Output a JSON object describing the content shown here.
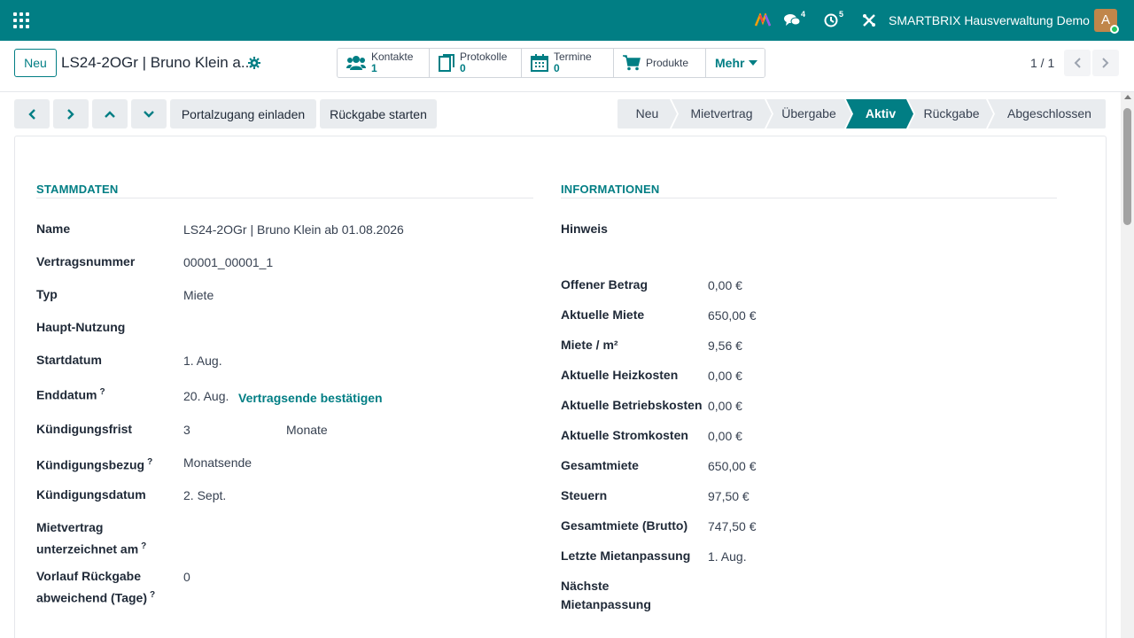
{
  "topbar": {
    "bg_color": "#017e84",
    "discuss_count": "4",
    "activity_count": "5",
    "company_name": "SMARTBRIX Hausverwaltung Demo",
    "avatar_letter": "A"
  },
  "control": {
    "new_label": "Neu",
    "record_title": "LS24-2OGr | Bruno Klein a...",
    "smart_buttons": [
      {
        "label": "Kontakte",
        "count": "1",
        "icon": "users-icon"
      },
      {
        "label": "Protokolle",
        "count": "0",
        "icon": "document-icon"
      },
      {
        "label": "Termine",
        "count": "0",
        "icon": "calendar-icon"
      },
      {
        "label": "Produkte",
        "count": "",
        "icon": "cart-icon"
      }
    ],
    "more_label": "Mehr",
    "pager": "1 / 1"
  },
  "actions": {
    "invite_label": "Portalzugang einladen",
    "return_label": "Rückgabe starten"
  },
  "stages": {
    "items": [
      "Neu",
      "Mietvertrag",
      "Übergabe",
      "Aktiv",
      "Rückgabe",
      "Abgeschlossen"
    ],
    "active": "Aktiv",
    "active_color": "#017e84"
  },
  "stammdaten": {
    "title": "STAMMDATEN",
    "name_label": "Name",
    "name_value": "LS24-2OGr | Bruno Klein ab 01.08.2026",
    "contract_no_label": "Vertragsnummer",
    "contract_no_value": "00001_00001_1",
    "type_label": "Typ",
    "type_value": "Miete",
    "usage_label": "Haupt-Nutzung",
    "start_label": "Startdatum",
    "start_value": "1. Aug.",
    "end_label": "Enddatum",
    "end_value": "20. Aug.",
    "end_confirm_link": "Vertragsende bestätigen",
    "notice_label": "Kündigungsfrist",
    "notice_value": "3",
    "notice_unit": "Monate",
    "notice_ref_label": "Kündigungsbezug",
    "notice_ref_value": "Monatsende",
    "notice_date_label": "Kündigungsdatum",
    "notice_date_value": "2. Sept.",
    "signed_label_1": "Mietvertrag",
    "signed_label_2": "unterzeichnet am",
    "lead_label_1": "Vorlauf Rückgabe",
    "lead_label_2": "abweichend (Tage)",
    "lead_value": "0",
    "help_mark": "?"
  },
  "informationen": {
    "title": "INFORMATIONEN",
    "hint_label": "Hinweis",
    "rows": [
      {
        "label": "Offener Betrag",
        "value": "0,00 €"
      },
      {
        "label": "Aktuelle Miete",
        "value": "650,00 €"
      },
      {
        "label": "Miete / m²",
        "value": "9,56 €"
      },
      {
        "label": "Aktuelle Heizkosten",
        "value": "0,00 €"
      },
      {
        "label": "Aktuelle Betriebskosten",
        "value": "0,00 €"
      },
      {
        "label": "Aktuelle Stromkosten",
        "value": "0,00 €"
      },
      {
        "label": "Gesamtmiete",
        "value": "650,00 €"
      },
      {
        "label": "Steuern",
        "value": "97,50 €"
      },
      {
        "label": "Gesamtmiete (Brutto)",
        "value": "747,50 €"
      },
      {
        "label": "Letzte Mietanpassung",
        "value": "1. Aug."
      }
    ],
    "next_adjust_label_1": "Nächste",
    "next_adjust_label_2": "Mietanpassung"
  }
}
